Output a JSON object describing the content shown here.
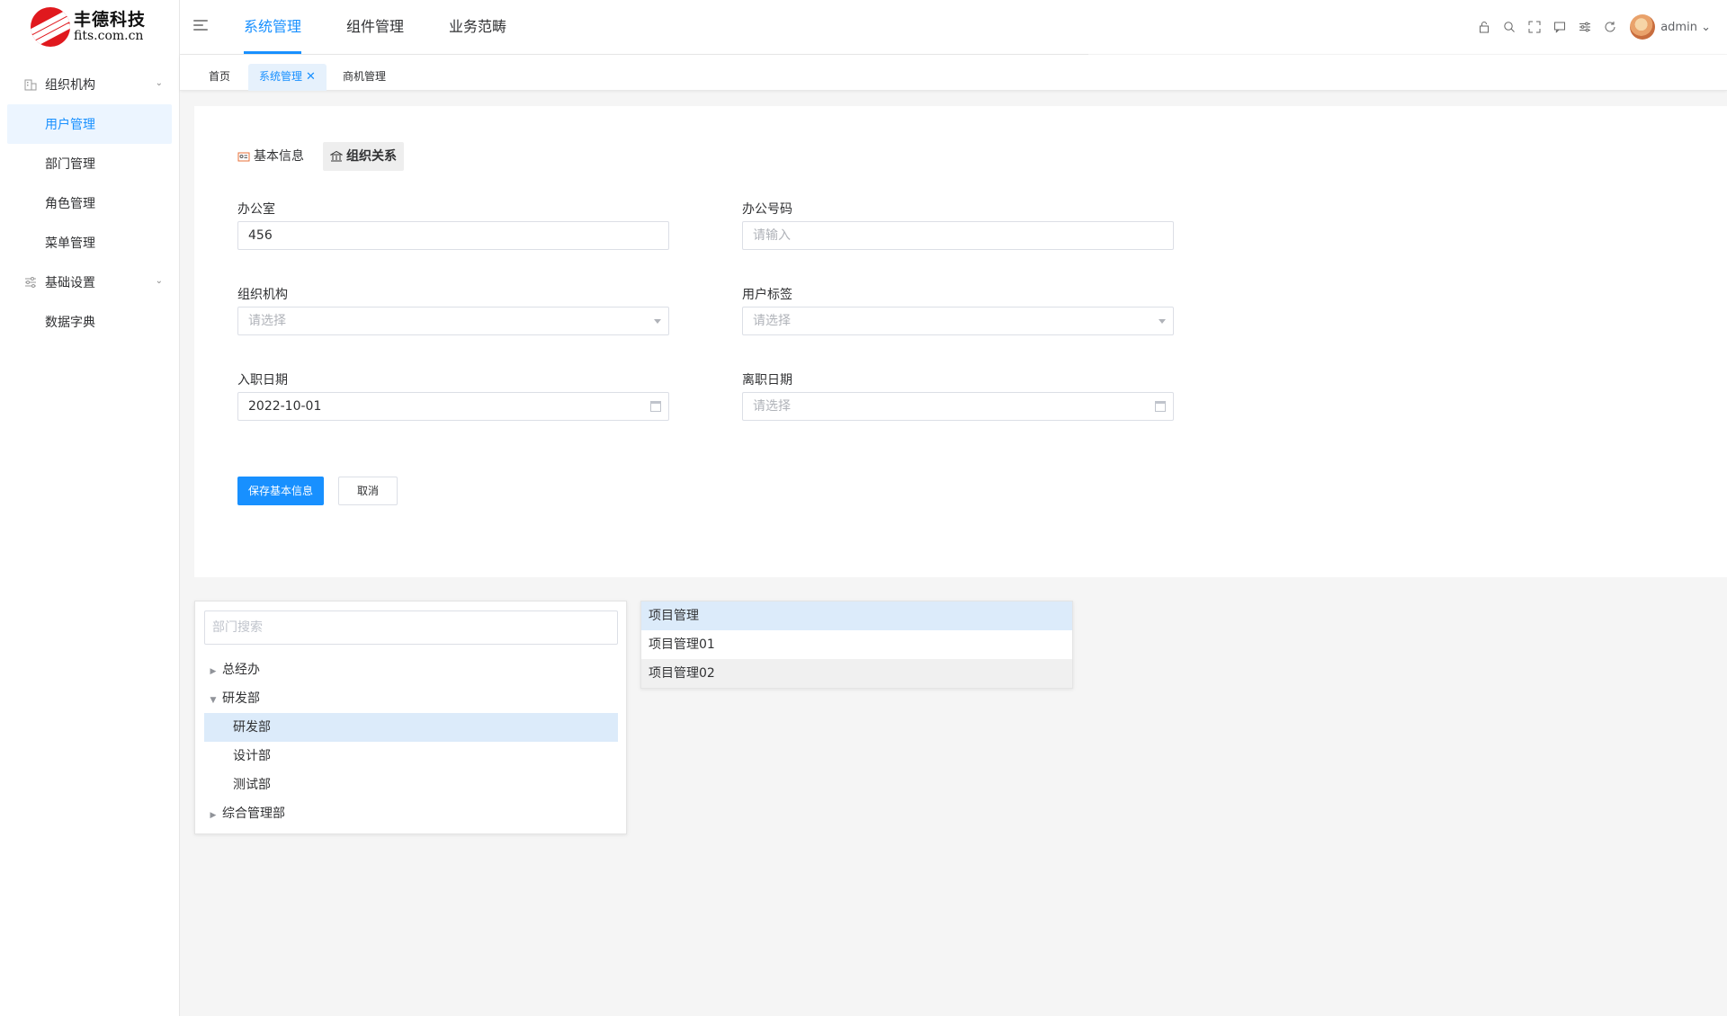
{
  "logo": {
    "cn": "丰德科技",
    "en": "fits.com.cn"
  },
  "sidebar": {
    "groups": [
      {
        "label": "组织机构",
        "icon": "building-icon",
        "items": [
          "用户管理",
          "部门管理",
          "角色管理",
          "菜单管理"
        ],
        "active_item": "用户管理"
      },
      {
        "label": "基础设置",
        "icon": "sliders-icon",
        "items": [
          "数据字典"
        ]
      }
    ]
  },
  "header": {
    "tabs": [
      "系统管理",
      "组件管理",
      "业务范畴"
    ],
    "active_tab": "系统管理",
    "icons": [
      "lock-icon",
      "search-icon",
      "fullscreen-icon",
      "message-icon",
      "settings-icon",
      "refresh-icon"
    ],
    "user": "admin"
  },
  "tags": {
    "items": [
      "首页",
      "系统管理",
      "商机管理"
    ],
    "active": "系统管理"
  },
  "form": {
    "subtabs": [
      {
        "label": "基本信息",
        "icon": "idcard-icon"
      },
      {
        "label": "组织关系",
        "icon": "bank-icon"
      }
    ],
    "active_subtab": "组织关系",
    "fields": {
      "office": {
        "label": "办公室",
        "value": "456"
      },
      "office_phone": {
        "label": "办公号码",
        "placeholder": "请输入"
      },
      "organization": {
        "label": "组织机构",
        "placeholder": "请选择"
      },
      "user_tag": {
        "label": "用户标签",
        "placeholder": "请选择"
      },
      "entry_date": {
        "label": "入职日期",
        "value": "2022-10-01"
      },
      "leave_date": {
        "label": "离职日期",
        "placeholder": "请选择"
      }
    },
    "save_label": "保存基本信息",
    "cancel_label": "取消"
  },
  "tree": {
    "search_placeholder": "部门搜索",
    "nodes": [
      {
        "label": "总经办",
        "level": 0,
        "state": "collapsed"
      },
      {
        "label": "研发部",
        "level": 0,
        "state": "expanded"
      },
      {
        "label": "研发部",
        "level": 1,
        "selected": true
      },
      {
        "label": "设计部",
        "level": 1
      },
      {
        "label": "测试部",
        "level": 1
      },
      {
        "label": "综合管理部",
        "level": 0,
        "state": "collapsed"
      }
    ]
  },
  "list": {
    "items": [
      "项目管理",
      "项目管理01",
      "项目管理02"
    ],
    "selected": "项目管理",
    "hovered": "项目管理02"
  },
  "colors": {
    "accent": "#1890ff",
    "selected_bg": "#dcebfa"
  }
}
